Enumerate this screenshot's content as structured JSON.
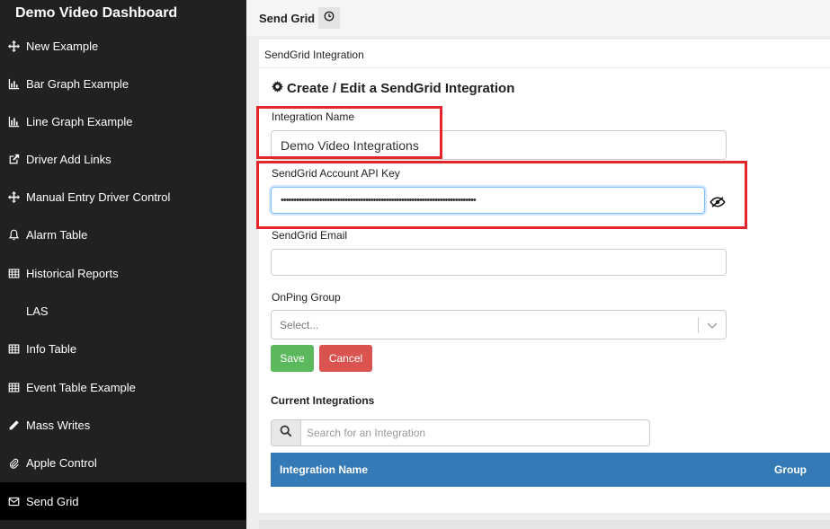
{
  "sidebar": {
    "brand": "Demo Video Dashboard",
    "items": [
      {
        "label": "New Example",
        "icon": "move-icon"
      },
      {
        "label": "Bar Graph Example",
        "icon": "bar-chart-icon"
      },
      {
        "label": "Line Graph Example",
        "icon": "line-chart-icon"
      },
      {
        "label": "Driver Add Links",
        "icon": "external-link-icon"
      },
      {
        "label": "Manual Entry Driver Control",
        "icon": "move-icon"
      },
      {
        "label": "Alarm Table",
        "icon": "bell-icon"
      },
      {
        "label": "Historical Reports",
        "icon": "table-icon"
      },
      {
        "label": "LAS",
        "icon": ""
      },
      {
        "label": "Info Table",
        "icon": "table-icon"
      },
      {
        "label": "Event Table Example",
        "icon": "table-icon"
      },
      {
        "label": "Mass Writes",
        "icon": "pencil-icon"
      },
      {
        "label": "Apple Control",
        "icon": "paperclip-icon"
      },
      {
        "label": "Send Grid",
        "icon": "envelope-icon"
      }
    ]
  },
  "header": {
    "title": "Send Grid",
    "clock_icon": "clock-icon"
  },
  "panel": {
    "title": "SendGrid Integration",
    "form_heading": "Create / Edit a SendGrid Integration",
    "fields": {
      "integration_name_label": "Integration Name",
      "integration_name_value": "Demo Video Integrations",
      "api_key_label": "SendGrid Account API Key",
      "api_key_value": "••••••••••••••••••••••••••••••••••••••••••••••••••••••••••••••••••••••••••••",
      "email_label": "SendGrid Email",
      "email_value": "",
      "group_label": "OnPing Group",
      "group_placeholder": "Select..."
    },
    "buttons": {
      "save": "Save",
      "cancel": "Cancel"
    },
    "current": {
      "title": "Current Integrations",
      "search_placeholder": "Search for an Integration",
      "columns": [
        "Integration Name",
        "Group"
      ]
    }
  },
  "colors": {
    "sidebar_bg": "#212121",
    "highlight": "#e3262c",
    "save": "#5cb85c",
    "cancel": "#d9534f",
    "table_header": "#337ab7"
  }
}
